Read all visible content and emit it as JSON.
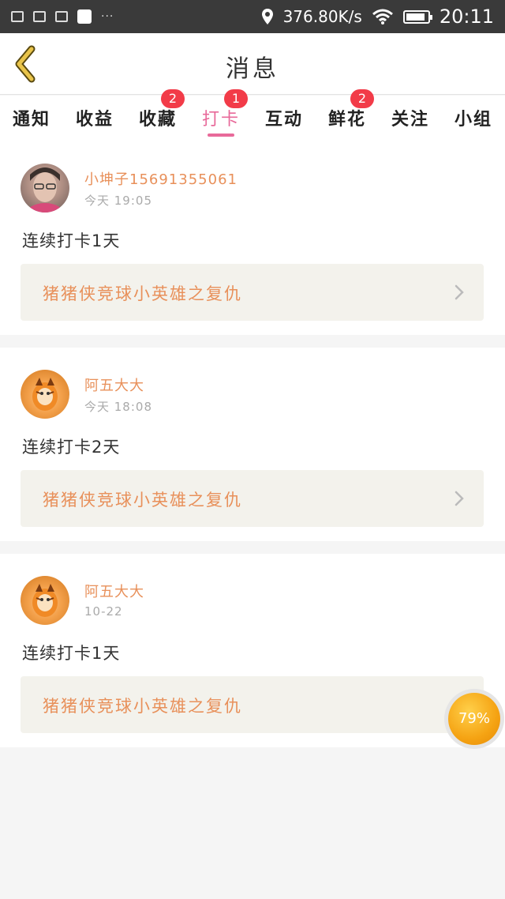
{
  "status_bar": {
    "network_speed": "376.80K/s",
    "time": "20:11",
    "battery_percent": 90,
    "more": "···"
  },
  "header": {
    "title": "消息"
  },
  "tabs": [
    {
      "label": "通知",
      "badge": "",
      "active": false
    },
    {
      "label": "收益",
      "badge": "",
      "active": false
    },
    {
      "label": "收藏",
      "badge": "2",
      "active": false
    },
    {
      "label": "打卡",
      "badge": "1",
      "active": true
    },
    {
      "label": "互动",
      "badge": "",
      "active": false
    },
    {
      "label": "鲜花",
      "badge": "2",
      "active": false
    },
    {
      "label": "关注",
      "badge": "",
      "active": false
    },
    {
      "label": "小组",
      "badge": "",
      "active": false
    }
  ],
  "messages": [
    {
      "user": "小坤子15691355061",
      "time": "今天 19:05",
      "text": "连续打卡1天",
      "link": "猪猪侠竞球小英雄之复仇"
    },
    {
      "user": "阿五大大",
      "time": "今天 18:08",
      "text": "连续打卡2天",
      "link": "猪猪侠竞球小英雄之复仇"
    },
    {
      "user": "阿五大大",
      "time": "10-22",
      "text": "连续打卡1天",
      "link": "猪猪侠竞球小英雄之复仇"
    }
  ],
  "float_progress": "79%",
  "colors": {
    "accent_pink": "#e86a9a",
    "name_orange": "#e8905a",
    "badge_red": "#f23b48",
    "back_yellow": "#e9c44a"
  },
  "icons": {
    "back": "chevron-left-icon",
    "link_arrow": "chevron-right-icon"
  }
}
